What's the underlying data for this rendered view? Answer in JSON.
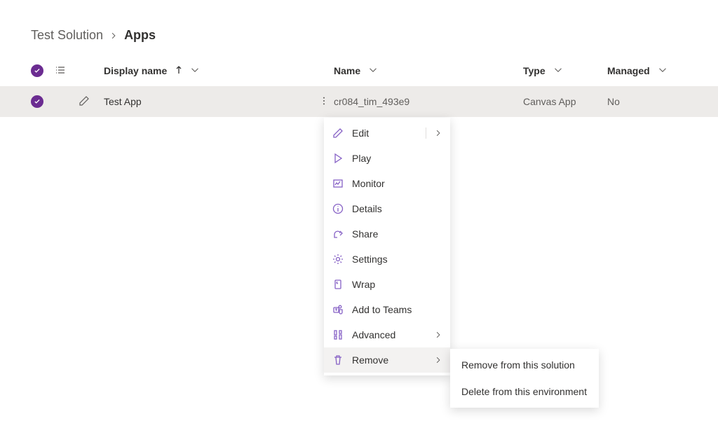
{
  "breadcrumb": {
    "parent": "Test Solution",
    "current": "Apps"
  },
  "columns": {
    "displayName": "Display name",
    "name": "Name",
    "type": "Type",
    "managed": "Managed"
  },
  "row": {
    "displayName": "Test App",
    "name": "cr084_tim_493e9",
    "type": "Canvas App",
    "managed": "No"
  },
  "menu": {
    "edit": "Edit",
    "play": "Play",
    "monitor": "Monitor",
    "details": "Details",
    "share": "Share",
    "settings": "Settings",
    "wrap": "Wrap",
    "addToTeams": "Add to Teams",
    "advanced": "Advanced",
    "remove": "Remove"
  },
  "submenu": {
    "removeFromSolution": "Remove from this solution",
    "deleteFromEnvironment": "Delete from this environment"
  }
}
